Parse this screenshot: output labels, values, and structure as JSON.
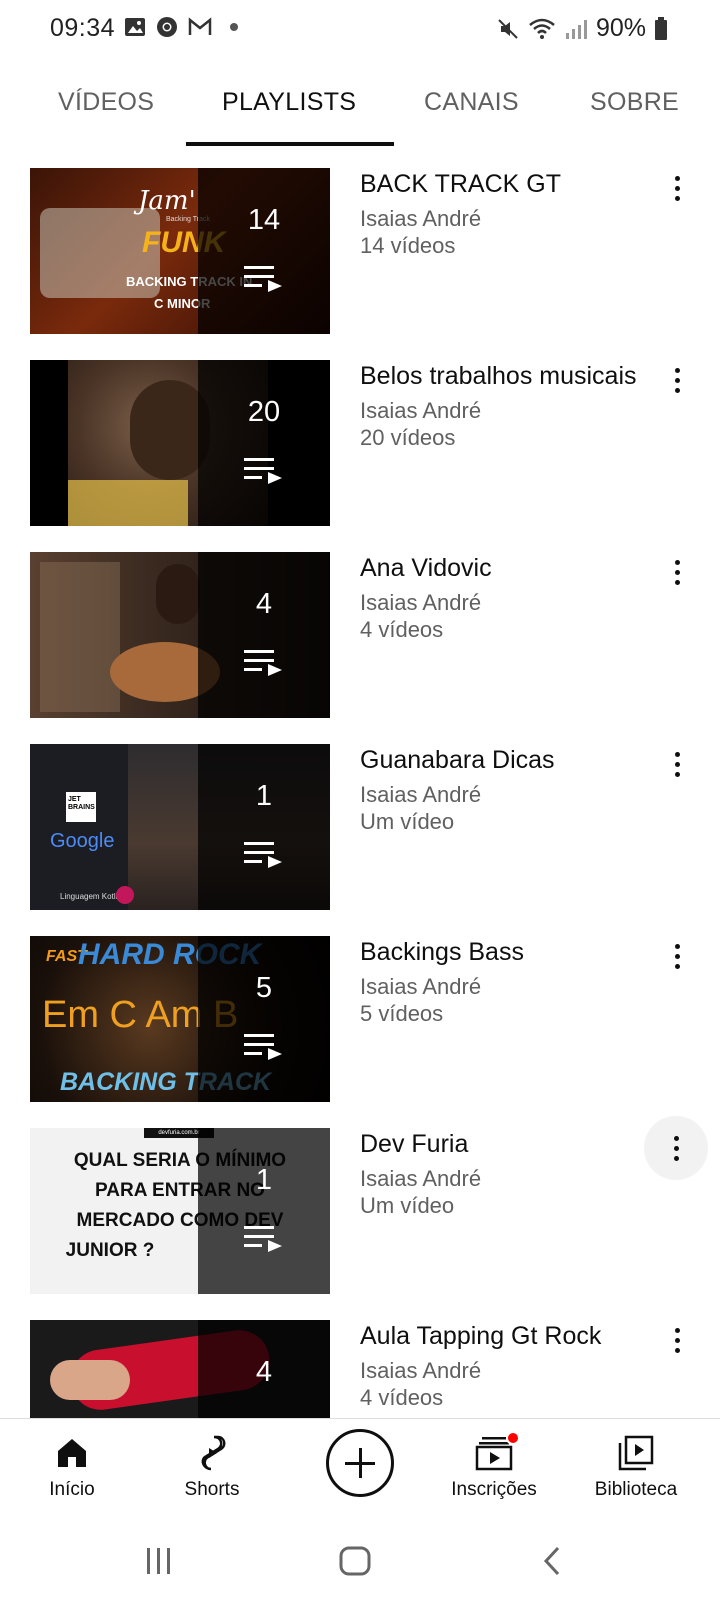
{
  "status": {
    "time": "09:34",
    "battery": "90%"
  },
  "tabs": [
    {
      "label": "VÍDEOS"
    },
    {
      "label": "PLAYLISTS"
    },
    {
      "label": "CANAIS"
    },
    {
      "label": "SOBRE"
    }
  ],
  "playlists": [
    {
      "title": "BACK TRACK GT",
      "channel": "Isaias André",
      "meta": "14 vídeos",
      "count": "14",
      "thumb_text": [
        "Jam'",
        "Backing Track",
        "FUNK",
        "BACKING TRACK IN",
        "C MINOR"
      ]
    },
    {
      "title": "Belos trabalhos musicais",
      "channel": "Isaias André",
      "meta": "20 vídeos",
      "count": "20"
    },
    {
      "title": "Ana Vidovic",
      "channel": "Isaias André",
      "meta": "4 vídeos",
      "count": "4"
    },
    {
      "title": "Guanabara Dicas",
      "channel": "Isaias André",
      "meta": "Um vídeo",
      "count": "1",
      "thumb_text": [
        "JET BRAINS",
        "Google",
        "Linguagem Kotlin"
      ]
    },
    {
      "title": "Backings Bass",
      "channel": "Isaias André",
      "meta": "5 vídeos",
      "count": "5",
      "thumb_text": [
        "FAST",
        "HARD ROCK",
        "Em C Am B",
        "BACKING TRACK"
      ]
    },
    {
      "title": "Dev Furia",
      "channel": "Isaias André",
      "meta": "Um vídeo",
      "count": "1",
      "thumb_text": [
        "devfuria.com.br",
        "QUAL SERIA O MÍNIMO",
        "PARA ENTRAR NO",
        "MERCADO COMO DEV",
        "JUNIOR ?"
      ]
    },
    {
      "title": "Aula Tapping Gt Rock",
      "channel": "Isaias André",
      "meta": "4 vídeos",
      "count": "4"
    }
  ],
  "bottom_nav": [
    {
      "label": "Início",
      "icon": "home-icon"
    },
    {
      "label": "Shorts",
      "icon": "shorts-icon"
    },
    {
      "label": "",
      "icon": "create-icon"
    },
    {
      "label": "Inscrições",
      "icon": "subscriptions-icon"
    },
    {
      "label": "Biblioteca",
      "icon": "library-icon"
    }
  ],
  "colors": {
    "text_primary": "#0f0f0f",
    "text_secondary": "#606060",
    "notification": "#ff0000"
  }
}
